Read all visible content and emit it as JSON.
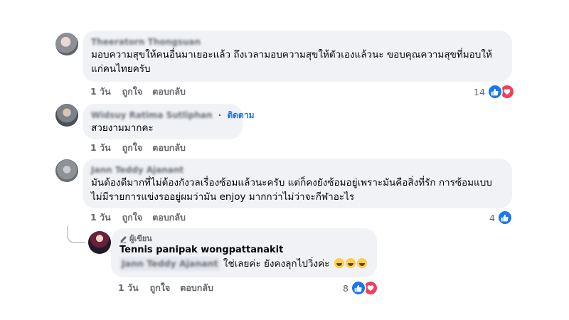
{
  "comments": [
    {
      "name": "Theeratorn Thongsuan",
      "text": "มอบความสุขให้คนอื่นมาเยอะแล้ว ถึงเวลามอบความสุขให้ตัวเองแล้วนะ ขอบคุณความสุขที่มอบให้แก่คนไทยครับ",
      "time": "1 วัน",
      "like": "ถูกใจ",
      "reply": "ตอบกลับ",
      "reaction_count": "14"
    },
    {
      "name": "Widsuy Ratima Sutliphan",
      "follow": "ติดตาม",
      "text": "สวยงามมากคะ",
      "time": "1 วัน",
      "like": "ถูกใจ",
      "reply": "ตอบกลับ"
    },
    {
      "name": "Jann Teddy Ajanant",
      "text": "มันต้องดีมากที่ไม่ต้องกังวลเรื่องซ้อมแล้วนะครับ แต่ก็คงยังซ้อมอยู่เพราะมันคือสิ่งที่รัก การซ้อมแบบไม่มีรายการแข่งรออยู่ผมว่ามัน enjoy มากกว่าไม่ว่าจะกีฬาอะไร",
      "time": "1 วัน",
      "like": "ถูกใจ",
      "reply": "ตอบกลับ",
      "reaction_count": "4"
    }
  ],
  "reply": {
    "badge": "ผู้เขียน",
    "name": "Tennis panipak wongpattanakit",
    "mention": "Jann Teddy Ajanant",
    "text": "ใช่เลยค่ะ ยังคงลุกไปวิ่งค่ะ",
    "time": "1 วัน",
    "like": "ถูกใจ",
    "reply": "ตอบกลับ",
    "reaction_count": "8"
  },
  "icons": {
    "like": "like-icon",
    "love": "love-icon",
    "pen": "pen-icon",
    "laugh": "laugh-emoji"
  },
  "colors": {
    "bubble": "#f0f2f5",
    "like": "#1877f2",
    "love": "#f33e58",
    "follow": "#216fdb"
  }
}
